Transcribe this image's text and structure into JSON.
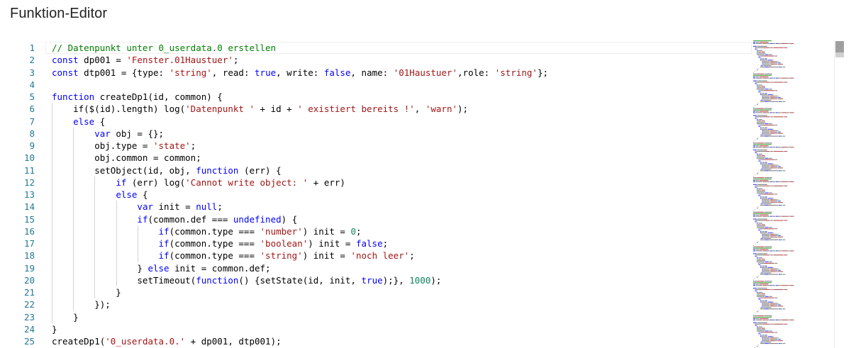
{
  "app": {
    "title": "Funktion-Editor"
  },
  "editor": {
    "language": "javascript",
    "line_numbers": [
      "1",
      "2",
      "3",
      "4",
      "5",
      "6",
      "7",
      "8",
      "9",
      "10",
      "11",
      "12",
      "13",
      "14",
      "15",
      "16",
      "17",
      "18",
      "19",
      "20",
      "21",
      "22",
      "23",
      "24",
      "25"
    ],
    "lines": [
      [
        [
          "comment",
          "// Datenpunkt unter 0_userdata.0 erstellen"
        ]
      ],
      [
        [
          "kw",
          "const"
        ],
        [
          "plain",
          " dp001 = "
        ],
        [
          "str",
          "'Fenster.01Haustuer'"
        ],
        [
          "plain",
          ";"
        ]
      ],
      [
        [
          "kw",
          "const"
        ],
        [
          "plain",
          " dtp001 = {type: "
        ],
        [
          "str",
          "'string'"
        ],
        [
          "plain",
          ", read: "
        ],
        [
          "kw",
          "true"
        ],
        [
          "plain",
          ", write: "
        ],
        [
          "kw",
          "false"
        ],
        [
          "plain",
          ", name: "
        ],
        [
          "str",
          "'01Haustuer'"
        ],
        [
          "plain",
          ",role: "
        ],
        [
          "str",
          "'string'"
        ],
        [
          "plain",
          "};"
        ]
      ],
      [],
      [
        [
          "kw",
          "function"
        ],
        [
          "plain",
          " createDp1(id, common) {"
        ]
      ],
      [
        [
          "plain",
          "    if($(id).length) log("
        ],
        [
          "str",
          "'Datenpunkt '"
        ],
        [
          "plain",
          " + id + "
        ],
        [
          "str",
          "' existiert bereits !'"
        ],
        [
          "plain",
          ", "
        ],
        [
          "str",
          "'warn'"
        ],
        [
          "plain",
          ");"
        ]
      ],
      [
        [
          "plain",
          "    "
        ],
        [
          "kw",
          "else"
        ],
        [
          "plain",
          " {"
        ]
      ],
      [
        [
          "plain",
          "        "
        ],
        [
          "kw",
          "var"
        ],
        [
          "plain",
          " obj = {};"
        ]
      ],
      [
        [
          "plain",
          "        obj.type = "
        ],
        [
          "str",
          "'state'"
        ],
        [
          "plain",
          ";"
        ]
      ],
      [
        [
          "plain",
          "        obj.common = common;"
        ]
      ],
      [
        [
          "plain",
          "        setObject(id, obj, "
        ],
        [
          "kw",
          "function"
        ],
        [
          "plain",
          " (err) {"
        ]
      ],
      [
        [
          "plain",
          "            "
        ],
        [
          "kw",
          "if"
        ],
        [
          "plain",
          " (err) log("
        ],
        [
          "str",
          "'Cannot write object: '"
        ],
        [
          "plain",
          " + err)"
        ]
      ],
      [
        [
          "plain",
          "            "
        ],
        [
          "kw",
          "else"
        ],
        [
          "plain",
          " {"
        ]
      ],
      [
        [
          "plain",
          "                "
        ],
        [
          "kw",
          "var"
        ],
        [
          "plain",
          " init = "
        ],
        [
          "kw",
          "null"
        ],
        [
          "plain",
          ";"
        ]
      ],
      [
        [
          "plain",
          "                "
        ],
        [
          "kw",
          "if"
        ],
        [
          "plain",
          "(common.def === "
        ],
        [
          "kw",
          "undefined"
        ],
        [
          "plain",
          ") {"
        ]
      ],
      [
        [
          "plain",
          "                    "
        ],
        [
          "kw",
          "if"
        ],
        [
          "plain",
          "(common.type === "
        ],
        [
          "str",
          "'number'"
        ],
        [
          "plain",
          ") init = "
        ],
        [
          "num",
          "0"
        ],
        [
          "plain",
          ";"
        ]
      ],
      [
        [
          "plain",
          "                    "
        ],
        [
          "kw",
          "if"
        ],
        [
          "plain",
          "(common.type === "
        ],
        [
          "str",
          "'boolean'"
        ],
        [
          "plain",
          ") init = "
        ],
        [
          "kw",
          "false"
        ],
        [
          "plain",
          ";"
        ]
      ],
      [
        [
          "plain",
          "                    "
        ],
        [
          "kw",
          "if"
        ],
        [
          "plain",
          "(common.type === "
        ],
        [
          "str",
          "'string'"
        ],
        [
          "plain",
          ") init = "
        ],
        [
          "str",
          "'noch leer'"
        ],
        [
          "plain",
          ";"
        ]
      ],
      [
        [
          "plain",
          "                } "
        ],
        [
          "kw",
          "else"
        ],
        [
          "plain",
          " init = common.def;"
        ]
      ],
      [
        [
          "plain",
          "                setTimeout("
        ],
        [
          "kw",
          "function"
        ],
        [
          "plain",
          "() {setState(id, init, "
        ],
        [
          "kw",
          "true"
        ],
        [
          "plain",
          ");}, "
        ],
        [
          "num",
          "1000"
        ],
        [
          "plain",
          ");"
        ]
      ],
      [
        [
          "plain",
          "            }"
        ]
      ],
      [
        [
          "plain",
          "        });"
        ]
      ],
      [
        [
          "plain",
          "    }"
        ]
      ],
      [
        [
          "plain",
          "}"
        ]
      ],
      [
        [
          "plain",
          "createDp1("
        ],
        [
          "str",
          "'0_userdata.0.'"
        ],
        [
          "plain",
          " + dp001, dtp001);"
        ]
      ]
    ]
  },
  "colors": {
    "comment": "#008000",
    "keyword": "#0000ff",
    "string": "#a31515",
    "number": "#098658",
    "line_number": "#237893",
    "text": "#000000"
  },
  "icons": {
    "minimap": "code-minimap",
    "scrollbar": "vertical-scrollbar"
  }
}
